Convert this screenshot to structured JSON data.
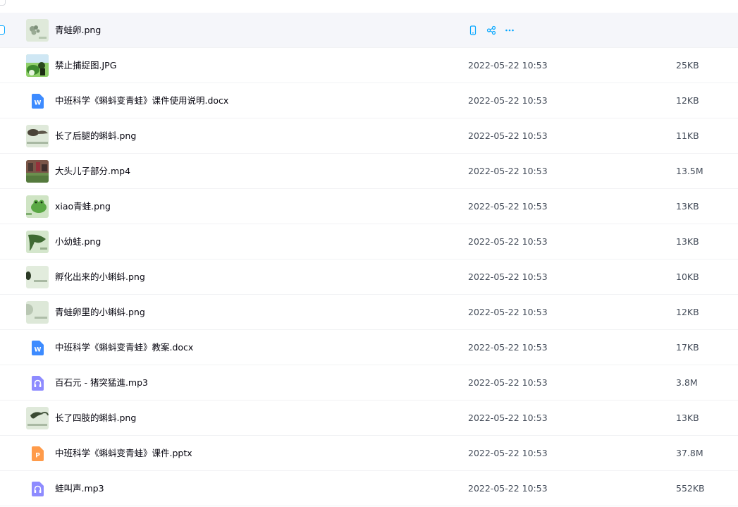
{
  "colors": {
    "accent": "#06a7ff",
    "hover_row": "#f5f6fa",
    "word_icon": "#3d8bff",
    "audio_icon": "#8e8bff",
    "ppt_icon": "#ff9b4a"
  },
  "files": [
    {
      "name": "青蛙卵.png",
      "type": "image",
      "thumb": "frog-egg",
      "date": "",
      "size": "",
      "hovered": true
    },
    {
      "name": "禁止捕捉图.JPG",
      "type": "image",
      "thumb": "no-catch",
      "date": "2022-05-22 10:53",
      "size": "25KB"
    },
    {
      "name": "中班科学《蝌蚪变青蛙》课件使用说明.docx",
      "type": "word",
      "date": "2022-05-22 10:53",
      "size": "12KB"
    },
    {
      "name": "长了后腿的蝌蚪.png",
      "type": "image",
      "thumb": "tadpole-legs",
      "date": "2022-05-22 10:53",
      "size": "11KB"
    },
    {
      "name": "大头儿子部分.mp4",
      "type": "video",
      "thumb": "video-still",
      "date": "2022-05-22 10:53",
      "size": "13.5M"
    },
    {
      "name": "xiao青蛙.png",
      "type": "image",
      "thumb": "frog",
      "date": "2022-05-22 10:53",
      "size": "13KB"
    },
    {
      "name": "小幼蛙.png",
      "type": "image",
      "thumb": "young-frog",
      "date": "2022-05-22 10:53",
      "size": "13KB"
    },
    {
      "name": "孵化出来的小蝌蚪.png",
      "type": "image",
      "thumb": "hatched-tadpole",
      "date": "2022-05-22 10:53",
      "size": "10KB"
    },
    {
      "name": "青蛙卵里的小蝌蚪.png",
      "type": "image",
      "thumb": "tadpole-in-egg",
      "date": "2022-05-22 10:53",
      "size": "12KB"
    },
    {
      "name": "中班科学《蝌蚪变青蛙》教案.docx",
      "type": "word",
      "date": "2022-05-22 10:53",
      "size": "17KB"
    },
    {
      "name": "百石元 - 猪突猛進.mp3",
      "type": "audio",
      "date": "2022-05-22 10:53",
      "size": "3.8M"
    },
    {
      "name": "长了四肢的蝌蚪.png",
      "type": "image",
      "thumb": "four-legs-tadpole",
      "date": "2022-05-22 10:53",
      "size": "13KB"
    },
    {
      "name": "中班科学《蝌蚪变青蛙》课件.pptx",
      "type": "ppt",
      "date": "2022-05-22 10:53",
      "size": "37.8M"
    },
    {
      "name": "蛙叫声.mp3",
      "type": "audio",
      "date": "2022-05-22 10:53",
      "size": "552KB"
    }
  ],
  "hover_actions": [
    "phone-icon",
    "share-icon",
    "more-icon"
  ]
}
